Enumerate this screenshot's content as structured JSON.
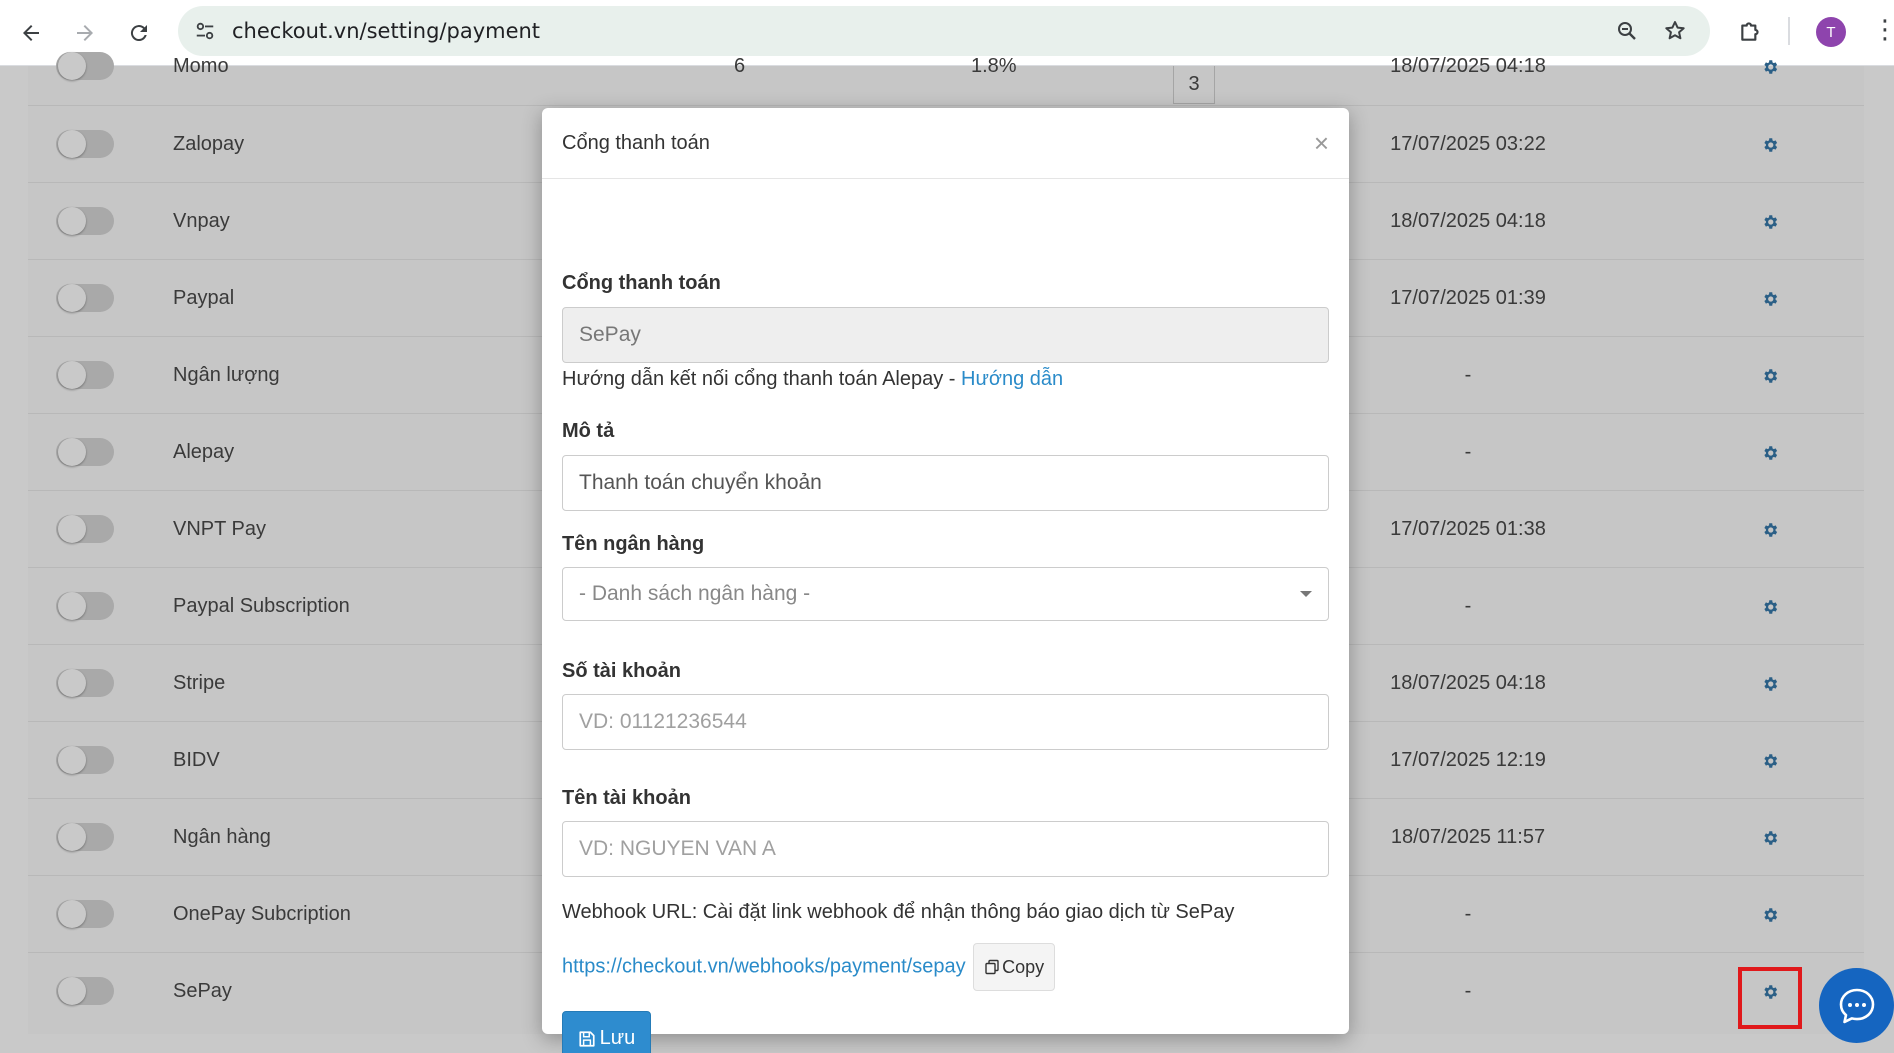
{
  "browser": {
    "url": "checkout.vn/setting/payment",
    "profile_initial": "T"
  },
  "table": {
    "rows": [
      {
        "name": "Momo",
        "count": "6",
        "fee": "1.8%",
        "order": "3",
        "date": "18/07/2025 04:18"
      },
      {
        "name": "Zalopay",
        "date": "17/07/2025 03:22"
      },
      {
        "name": "Vnpay",
        "date": "18/07/2025 04:18"
      },
      {
        "name": "Paypal",
        "date": "17/07/2025 01:39"
      },
      {
        "name": "Ngân lượng",
        "date": "-"
      },
      {
        "name": "Alepay",
        "date": "-"
      },
      {
        "name": "VNPT Pay",
        "date": "17/07/2025 01:38"
      },
      {
        "name": "Paypal Subscription",
        "date": "-"
      },
      {
        "name": "Stripe",
        "date": "18/07/2025 04:18"
      },
      {
        "name": "BIDV",
        "date": "17/07/2025 12:19"
      },
      {
        "name": "Ngân hàng",
        "date": "18/07/2025 11:57"
      },
      {
        "name": "OnePay Subcription",
        "date": "-"
      },
      {
        "name": "SePay",
        "date": "-"
      }
    ]
  },
  "modal": {
    "title": "Cổng thanh toán",
    "close_label": "×",
    "gateway_label": "Cổng thanh toán",
    "gateway_value": "SePay",
    "guide_text": "Hướng dẫn kết nối cổng thanh toán Alepay - ",
    "guide_link": "Hướng dẫn",
    "description_label": "Mô tả",
    "description_value": "Thanh toán chuyển khoản",
    "bank_label": "Tên ngân hàng",
    "bank_placeholder": "- Danh sách ngân hàng -",
    "account_number_label": "Số tài khoản",
    "account_number_placeholder": "VD: 01121236544",
    "account_name_label": "Tên tài khoản",
    "account_name_placeholder": "VD: NGUYEN VAN A",
    "webhook_text": "Webhook URL: Cài đặt link webhook để nhận thông báo giao dịch từ SePay",
    "webhook_url": "https://checkout.vn/webhooks/payment/sepay",
    "copy_label": "Copy",
    "save_label": "Lưu"
  },
  "colors": {
    "accent": "#2e8ccf",
    "link": "#2a8bc9",
    "highlight": "#e0181b",
    "chat": "#1565c0",
    "gear": "#2b5f86"
  }
}
